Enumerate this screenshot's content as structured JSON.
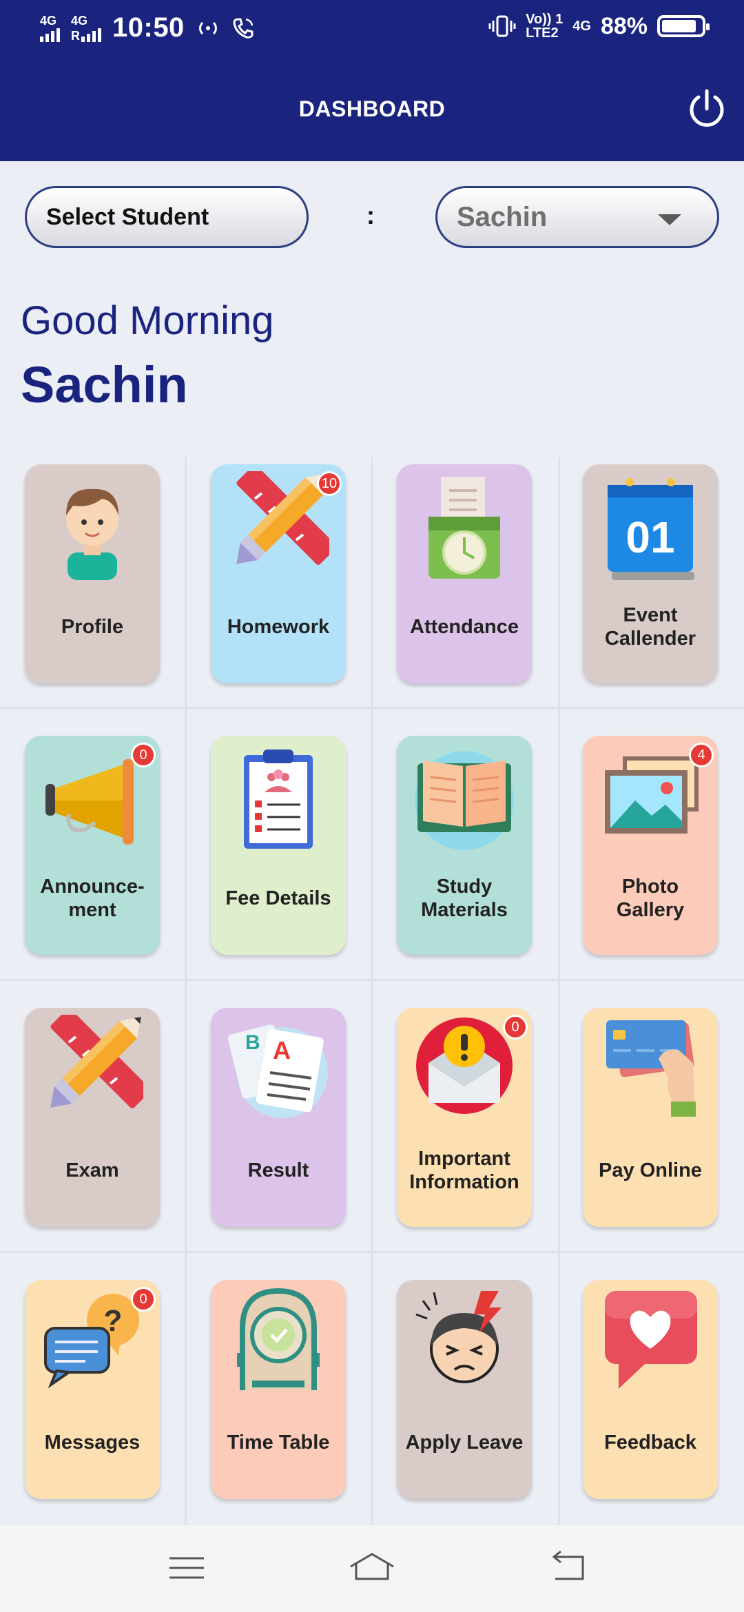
{
  "status_bar": {
    "net1": "4G",
    "net2": "4G",
    "net2_sub": "R",
    "time": "10:50",
    "volte": "Vo)) 1",
    "lte": "LTE2",
    "net3": "4G",
    "battery": "88%",
    "battery_level": 0.88
  },
  "header": {
    "title": "DASHBOARD"
  },
  "selector": {
    "label": "Select Student",
    "separator": ":",
    "selected": "Sachin"
  },
  "greeting": {
    "salutation": "Good Morning",
    "name": "Sachin"
  },
  "tiles": [
    {
      "label": "Profile",
      "icon": "profile-boy-icon",
      "bg": "#d9ccc8",
      "badge": ""
    },
    {
      "label": "Homework",
      "icon": "pencil-ruler-icon",
      "bg": "#b3e2f8",
      "badge": "10"
    },
    {
      "label": "Attendance",
      "icon": "attendance-clock-icon",
      "bg": "#dcc3ea",
      "badge": ""
    },
    {
      "label": "Event Callender",
      "icon": "calendar-icon",
      "bg": "#d9ccc8",
      "badge": ""
    },
    {
      "label": "Announce-ment",
      "icon": "megaphone-icon",
      "bg": "#b2e0d9",
      "badge": "0"
    },
    {
      "label": "Fee Details",
      "icon": "clipboard-icon",
      "bg": "#dfeecb",
      "badge": ""
    },
    {
      "label": "Study Materials",
      "icon": "open-book-icon",
      "bg": "#b2e0d9",
      "badge": ""
    },
    {
      "label": "Photo Gallery",
      "icon": "photo-gallery-icon",
      "bg": "#fdcbb9",
      "badge": "4"
    },
    {
      "label": "Exam",
      "icon": "pencil-ruler-icon",
      "bg": "#d9ccc8",
      "badge": ""
    },
    {
      "label": "Result",
      "icon": "result-papers-icon",
      "bg": "#dcc3ea",
      "badge": ""
    },
    {
      "label": "Important Information",
      "icon": "alert-envelope-icon",
      "bg": "#fde0b2",
      "badge": "0"
    },
    {
      "label": "Pay Online",
      "icon": "credit-card-icon",
      "bg": "#fde0b2",
      "badge": ""
    },
    {
      "label": "Messages",
      "icon": "chat-bubbles-icon",
      "bg": "#fde0b2",
      "badge": "0"
    },
    {
      "label": "Time Table",
      "icon": "table-clock-icon",
      "bg": "#fdcbb9",
      "badge": ""
    },
    {
      "label": "Apply Leave",
      "icon": "sick-face-icon",
      "bg": "#d9ccc8",
      "badge": ""
    },
    {
      "label": "Feedback",
      "icon": "heart-message-icon",
      "bg": "#fde0b2",
      "badge": ""
    }
  ],
  "calendar_day": "01",
  "navbar": {
    "items": [
      "menu-icon",
      "home-icon",
      "back-icon"
    ]
  }
}
